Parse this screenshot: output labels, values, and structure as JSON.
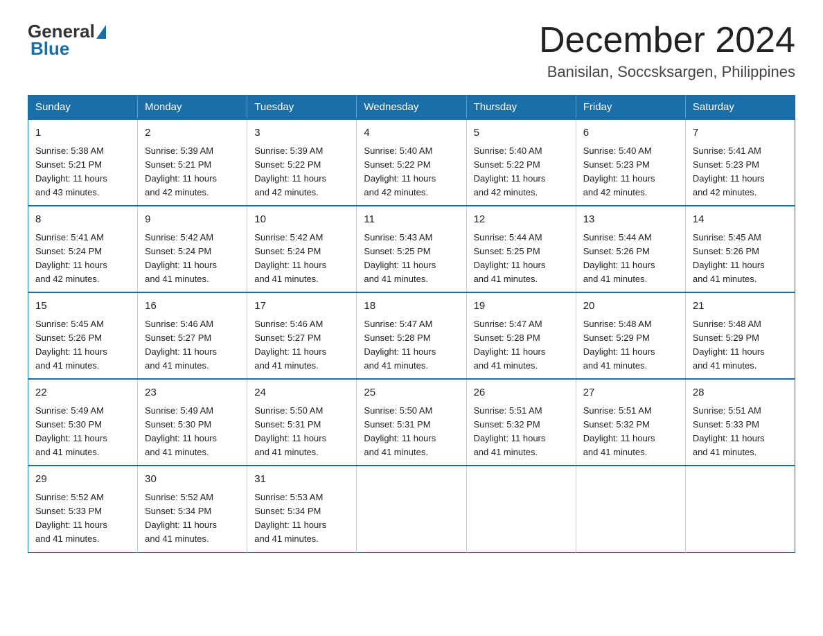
{
  "header": {
    "logo": {
      "general": "General",
      "blue": "Blue"
    },
    "title": "December 2024",
    "location": "Banisilan, Soccsksargen, Philippines"
  },
  "weekdays": [
    "Sunday",
    "Monday",
    "Tuesday",
    "Wednesday",
    "Thursday",
    "Friday",
    "Saturday"
  ],
  "weeks": [
    [
      {
        "day": "1",
        "sunrise": "5:38 AM",
        "sunset": "5:21 PM",
        "daylight": "11 hours and 43 minutes."
      },
      {
        "day": "2",
        "sunrise": "5:39 AM",
        "sunset": "5:21 PM",
        "daylight": "11 hours and 42 minutes."
      },
      {
        "day": "3",
        "sunrise": "5:39 AM",
        "sunset": "5:22 PM",
        "daylight": "11 hours and 42 minutes."
      },
      {
        "day": "4",
        "sunrise": "5:40 AM",
        "sunset": "5:22 PM",
        "daylight": "11 hours and 42 minutes."
      },
      {
        "day": "5",
        "sunrise": "5:40 AM",
        "sunset": "5:22 PM",
        "daylight": "11 hours and 42 minutes."
      },
      {
        "day": "6",
        "sunrise": "5:40 AM",
        "sunset": "5:23 PM",
        "daylight": "11 hours and 42 minutes."
      },
      {
        "day": "7",
        "sunrise": "5:41 AM",
        "sunset": "5:23 PM",
        "daylight": "11 hours and 42 minutes."
      }
    ],
    [
      {
        "day": "8",
        "sunrise": "5:41 AM",
        "sunset": "5:24 PM",
        "daylight": "11 hours and 42 minutes."
      },
      {
        "day": "9",
        "sunrise": "5:42 AM",
        "sunset": "5:24 PM",
        "daylight": "11 hours and 41 minutes."
      },
      {
        "day": "10",
        "sunrise": "5:42 AM",
        "sunset": "5:24 PM",
        "daylight": "11 hours and 41 minutes."
      },
      {
        "day": "11",
        "sunrise": "5:43 AM",
        "sunset": "5:25 PM",
        "daylight": "11 hours and 41 minutes."
      },
      {
        "day": "12",
        "sunrise": "5:44 AM",
        "sunset": "5:25 PM",
        "daylight": "11 hours and 41 minutes."
      },
      {
        "day": "13",
        "sunrise": "5:44 AM",
        "sunset": "5:26 PM",
        "daylight": "11 hours and 41 minutes."
      },
      {
        "day": "14",
        "sunrise": "5:45 AM",
        "sunset": "5:26 PM",
        "daylight": "11 hours and 41 minutes."
      }
    ],
    [
      {
        "day": "15",
        "sunrise": "5:45 AM",
        "sunset": "5:26 PM",
        "daylight": "11 hours and 41 minutes."
      },
      {
        "day": "16",
        "sunrise": "5:46 AM",
        "sunset": "5:27 PM",
        "daylight": "11 hours and 41 minutes."
      },
      {
        "day": "17",
        "sunrise": "5:46 AM",
        "sunset": "5:27 PM",
        "daylight": "11 hours and 41 minutes."
      },
      {
        "day": "18",
        "sunrise": "5:47 AM",
        "sunset": "5:28 PM",
        "daylight": "11 hours and 41 minutes."
      },
      {
        "day": "19",
        "sunrise": "5:47 AM",
        "sunset": "5:28 PM",
        "daylight": "11 hours and 41 minutes."
      },
      {
        "day": "20",
        "sunrise": "5:48 AM",
        "sunset": "5:29 PM",
        "daylight": "11 hours and 41 minutes."
      },
      {
        "day": "21",
        "sunrise": "5:48 AM",
        "sunset": "5:29 PM",
        "daylight": "11 hours and 41 minutes."
      }
    ],
    [
      {
        "day": "22",
        "sunrise": "5:49 AM",
        "sunset": "5:30 PM",
        "daylight": "11 hours and 41 minutes."
      },
      {
        "day": "23",
        "sunrise": "5:49 AM",
        "sunset": "5:30 PM",
        "daylight": "11 hours and 41 minutes."
      },
      {
        "day": "24",
        "sunrise": "5:50 AM",
        "sunset": "5:31 PM",
        "daylight": "11 hours and 41 minutes."
      },
      {
        "day": "25",
        "sunrise": "5:50 AM",
        "sunset": "5:31 PM",
        "daylight": "11 hours and 41 minutes."
      },
      {
        "day": "26",
        "sunrise": "5:51 AM",
        "sunset": "5:32 PM",
        "daylight": "11 hours and 41 minutes."
      },
      {
        "day": "27",
        "sunrise": "5:51 AM",
        "sunset": "5:32 PM",
        "daylight": "11 hours and 41 minutes."
      },
      {
        "day": "28",
        "sunrise": "5:51 AM",
        "sunset": "5:33 PM",
        "daylight": "11 hours and 41 minutes."
      }
    ],
    [
      {
        "day": "29",
        "sunrise": "5:52 AM",
        "sunset": "5:33 PM",
        "daylight": "11 hours and 41 minutes."
      },
      {
        "day": "30",
        "sunrise": "5:52 AM",
        "sunset": "5:34 PM",
        "daylight": "11 hours and 41 minutes."
      },
      {
        "day": "31",
        "sunrise": "5:53 AM",
        "sunset": "5:34 PM",
        "daylight": "11 hours and 41 minutes."
      },
      null,
      null,
      null,
      null
    ]
  ],
  "labels": {
    "sunrise": "Sunrise:",
    "sunset": "Sunset:",
    "daylight": "Daylight:"
  }
}
